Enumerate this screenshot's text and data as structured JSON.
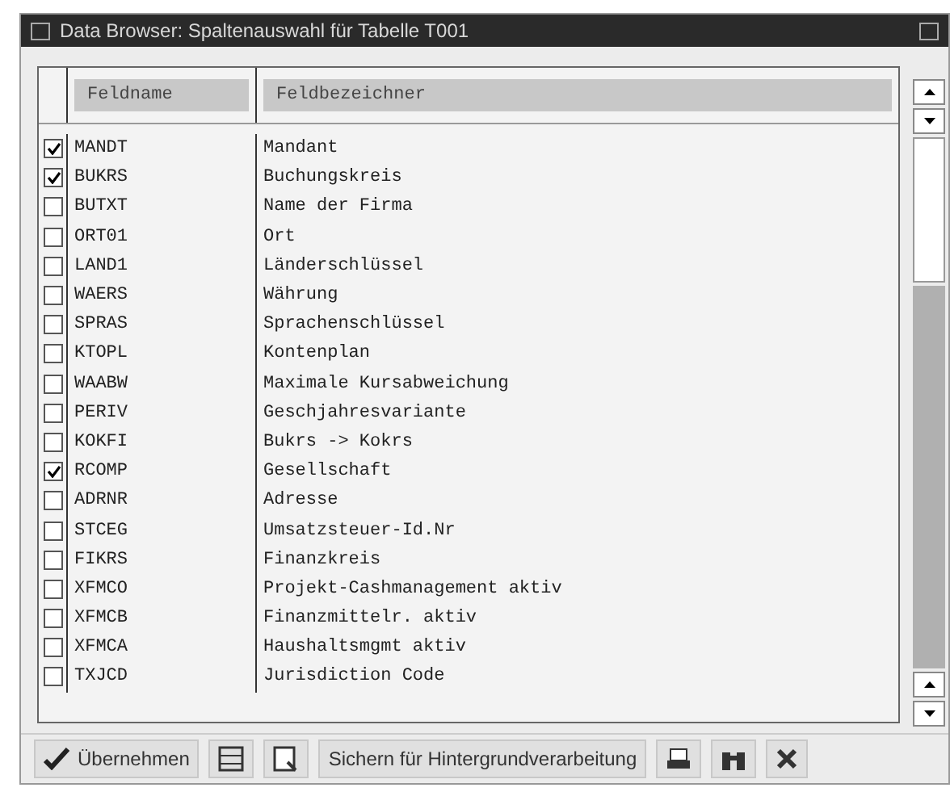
{
  "window": {
    "title": "Data Browser: Spaltenauswahl für Tabelle T001"
  },
  "table": {
    "columns": [
      "Feldname",
      "Feldbezeichner"
    ],
    "rows": [
      {
        "checked": true,
        "field": "MANDT",
        "label": "Mandant"
      },
      {
        "checked": true,
        "field": "BUKRS",
        "label": "Buchungskreis"
      },
      {
        "checked": false,
        "field": "BUTXT",
        "label": "Name der Firma"
      },
      {
        "checked": false,
        "field": "ORT01",
        "label": "Ort"
      },
      {
        "checked": false,
        "field": "LAND1",
        "label": "Länderschlüssel"
      },
      {
        "checked": false,
        "field": "WAERS",
        "label": "Währung"
      },
      {
        "checked": false,
        "field": "SPRAS",
        "label": "Sprachenschlüssel"
      },
      {
        "checked": false,
        "field": "KTOPL",
        "label": "Kontenplan"
      },
      {
        "checked": false,
        "field": "WAABW",
        "label": "Maximale Kursabweichung"
      },
      {
        "checked": false,
        "field": "PERIV",
        "label": "Geschjahresvariante"
      },
      {
        "checked": false,
        "field": "KOKFI",
        "label": "Bukrs -> Kokrs"
      },
      {
        "checked": true,
        "field": "RCOMP",
        "label": "Gesellschaft"
      },
      {
        "checked": false,
        "field": "ADRNR",
        "label": "Adresse"
      },
      {
        "checked": false,
        "field": "STCEG",
        "label": "Umsatzsteuer-Id.Nr"
      },
      {
        "checked": false,
        "field": "FIKRS",
        "label": "Finanzkreis"
      },
      {
        "checked": false,
        "field": "XFMCO",
        "label": "Projekt-Cashmanagement aktiv"
      },
      {
        "checked": false,
        "field": "XFMCB",
        "label": "Finanzmittelr. aktiv"
      },
      {
        "checked": false,
        "field": "XFMCA",
        "label": "Haushaltsmgmt aktiv"
      },
      {
        "checked": false,
        "field": "TXJCD",
        "label": "Jurisdiction Code"
      }
    ]
  },
  "toolbar": [
    {
      "kind": "text",
      "label": "Übernehmen"
    },
    {
      "kind": "icon"
    },
    {
      "kind": "icon"
    },
    {
      "kind": "text",
      "label": "Sichern für Hintergrundverarbeitung"
    },
    {
      "kind": "icon"
    },
    {
      "kind": "icon"
    },
    {
      "kind": "icon"
    }
  ]
}
